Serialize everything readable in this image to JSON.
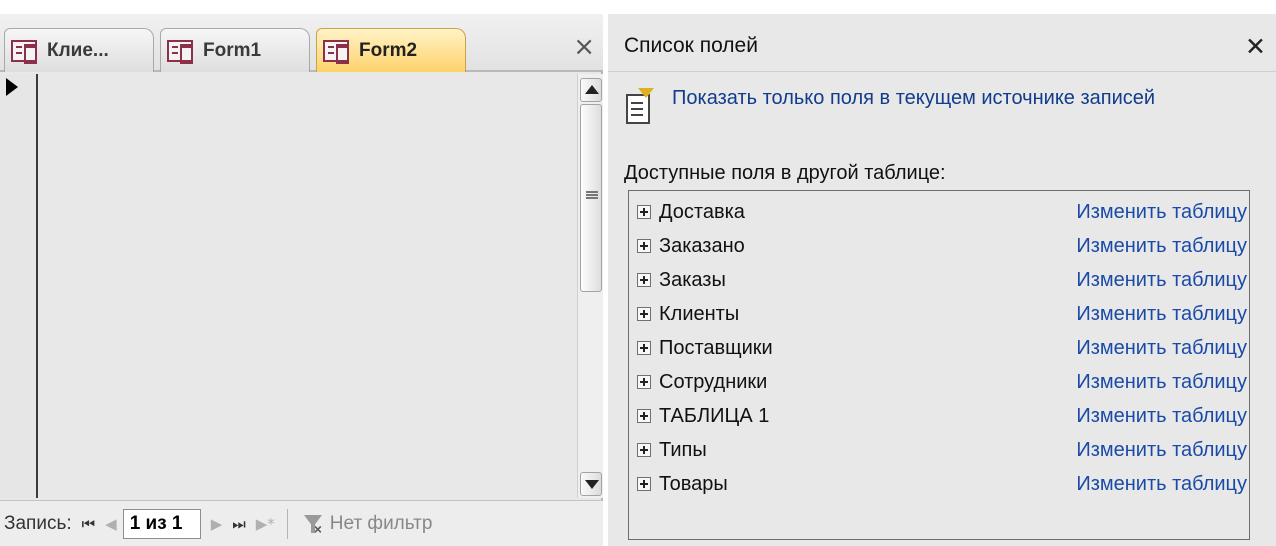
{
  "form_window": {
    "tabs": [
      {
        "label": "Клие...",
        "icon": "form-icon",
        "active": false
      },
      {
        "label": "Form1",
        "icon": "form-icon",
        "active": false
      },
      {
        "label": "Form2",
        "icon": "form-icon",
        "active": true
      }
    ],
    "close_glyph": "×"
  },
  "record_nav": {
    "label": "Запись:",
    "first_glyph": "⏮",
    "prev_glyph": "◀",
    "position": "1 из 1",
    "next_glyph": "▶",
    "last_glyph": "⏭",
    "new_glyph": "▶*",
    "filter_label": "Нет фильтр",
    "filter_icon": "filter-off-icon"
  },
  "field_list": {
    "title": "Список полей",
    "close_glyph": "✕",
    "show_only_link": "Показать только поля в текущем источнике записей",
    "other_tables_label": "Доступные поля в другой таблице:",
    "tables": [
      {
        "name": "Доставка",
        "action": "Изменить таблицу"
      },
      {
        "name": "Заказано",
        "action": "Изменить таблицу"
      },
      {
        "name": "Заказы",
        "action": "Изменить таблицу"
      },
      {
        "name": "Клиенты",
        "action": "Изменить таблицу"
      },
      {
        "name": "Поставщики",
        "action": "Изменить таблицу"
      },
      {
        "name": "Сотрудники",
        "action": "Изменить таблицу"
      },
      {
        "name": "ТАБЛИЦА 1",
        "action": "Изменить таблицу"
      },
      {
        "name": "Типы",
        "action": "Изменить таблицу"
      },
      {
        "name": "Товары",
        "action": "Изменить таблицу"
      }
    ]
  },
  "colors": {
    "link": "#1a4aa8",
    "active_tab": "#ffd26a",
    "form_icon": "#8c2f49"
  }
}
